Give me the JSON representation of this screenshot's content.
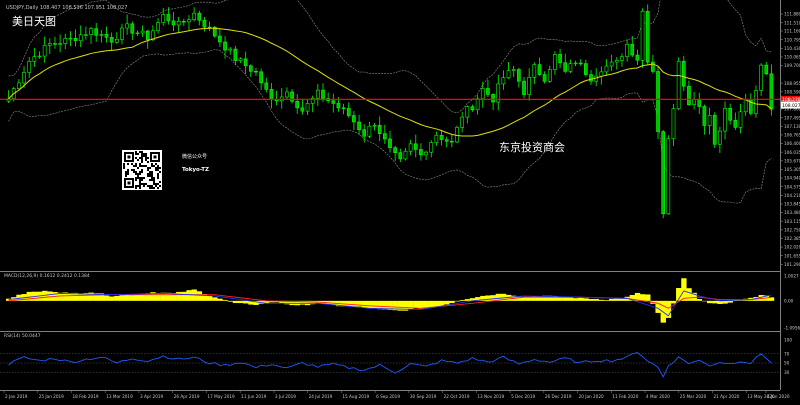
{
  "window": {
    "title": "USDJPY,Daily 108.407 108.536 107.951 108.027"
  },
  "colors": {
    "background": "#000000",
    "bull_candle": "#00ff00",
    "bear_candle": "#00c000",
    "ma_line": "#e0e000",
    "envelope": "#909090",
    "horizontal_line": "#ff0000",
    "current_price_box": "#ffffff",
    "macd_hist": "#ffff00",
    "macd_main": "#2030ff",
    "macd_signal": "#ff2020",
    "rsi_line": "#1e5bff",
    "grid": "#606060",
    "axis_text": "#c8c8c8",
    "overlay_text": "#ffffff"
  },
  "overlays": {
    "corner_label": "美日天图",
    "wechat_label": "微信公众号",
    "wechat_account": "Tokyo-TZ",
    "watermark": "东京投资商会",
    "qr_icon": "qr-code-icon"
  },
  "chart_data": {
    "type": "candlestick",
    "symbol": "USDJPY",
    "timeframe": "Daily",
    "ohlc_title": "USDJPY,Daily 108.407 108.536 107.951 108.027",
    "ylim": [
      101.05,
      112.05
    ],
    "y_ticks": [
      111.88,
      111.51,
      111.16,
      110.795,
      110.43,
      110.065,
      109.7,
      108.955,
      108.59,
      108.23,
      107.86,
      107.495,
      107.13,
      106.765,
      106.4,
      106.035,
      105.67,
      105.305,
      104.94,
      104.575,
      104.21,
      103.845,
      103.48,
      103.115,
      102.75,
      102.385,
      102.02,
      101.655,
      101.29
    ],
    "current_price": 108.027,
    "red_line_price": 108.27,
    "red_line_label": "108.270",
    "x_labels": [
      "2 Jan 2019",
      "25 Jan 2019",
      "18 Feb 2019",
      "13 Mar 2019",
      "3 Apr 2019",
      "26 Apr 2019",
      "17 May 2019",
      "11 Jun 2019",
      "3 Jul 2019",
      "24 Jul 2019",
      "15 Aug 2019",
      "6 Sep 2019",
      "30 Sep 2019",
      "22 Oct 2019",
      "13 Nov 2019",
      "5 Dec 2019",
      "26 Dec 2019",
      "20 Jan 2020",
      "11 Feb 2020",
      "4 Mar 2020",
      "25 Mar 2020",
      "21 Apr 2020",
      "13 May 2020",
      "4 Jun 2020"
    ],
    "price_path": [
      [
        0,
        108.3
      ],
      [
        4,
        109.9
      ],
      [
        8,
        110.6
      ],
      [
        12,
        110.8
      ],
      [
        16,
        111.2
      ],
      [
        20,
        110.8
      ],
      [
        23,
        111.3
      ],
      [
        27,
        110.9
      ],
      [
        30,
        111.8
      ],
      [
        33,
        111.4
      ],
      [
        36,
        111.9
      ],
      [
        40,
        111.0
      ],
      [
        44,
        110.0
      ],
      [
        48,
        109.4
      ],
      [
        51,
        108.2
      ],
      [
        54,
        108.6
      ],
      [
        57,
        107.8
      ],
      [
        60,
        108.5
      ],
      [
        63,
        108.1
      ],
      [
        66,
        107.6
      ],
      [
        69,
        106.8
      ],
      [
        71,
        107.3
      ],
      [
        74,
        106.1
      ],
      [
        76,
        105.6
      ],
      [
        78,
        106.3
      ],
      [
        80,
        105.9
      ],
      [
        83,
        106.8
      ],
      [
        86,
        106.4
      ],
      [
        88,
        107.6
      ],
      [
        90,
        108.0
      ],
      [
        92,
        108.7
      ],
      [
        94,
        108.3
      ],
      [
        96,
        109.2
      ],
      [
        98,
        109.5
      ],
      [
        100,
        108.6
      ],
      [
        102,
        109.6
      ],
      [
        104,
        109.2
      ],
      [
        106,
        110.1
      ],
      [
        108,
        109.4
      ],
      [
        110,
        109.9
      ],
      [
        113,
        109.2
      ],
      [
        115,
        109.6
      ],
      [
        118,
        109.8
      ],
      [
        120,
        110.6
      ],
      [
        122,
        110.0
      ],
      [
        123,
        112.0
      ],
      [
        124,
        110.0
      ],
      [
        125,
        109.5
      ],
      [
        126,
        107.0
      ],
      [
        127,
        103.5
      ],
      [
        128,
        106.5
      ],
      [
        129,
        108.0
      ],
      [
        130,
        110.0
      ],
      [
        131,
        109.0
      ],
      [
        132,
        108.0
      ],
      [
        133,
        108.4
      ],
      [
        134,
        108.0
      ],
      [
        135,
        107.3
      ],
      [
        136,
        107.6
      ],
      [
        137,
        106.4
      ],
      [
        138,
        107.1
      ],
      [
        139,
        107.8
      ],
      [
        140,
        107.4
      ],
      [
        141,
        107.0
      ],
      [
        142,
        107.8
      ],
      [
        143,
        108.1
      ],
      [
        144,
        107.6
      ],
      [
        145,
        108.6
      ],
      [
        146,
        109.8
      ],
      [
        147,
        109.4
      ],
      [
        148,
        108.0
      ]
    ],
    "total_bars": 149,
    "macd": {
      "label": "MACD(12,26,9) 0.1612 0.2412 0.1384",
      "ylim": [
        -1.0956,
        1.0027
      ],
      "y_ticks": [
        1.0027,
        0.0,
        -1.0956
      ],
      "hist_path": [
        [
          0,
          0.1
        ],
        [
          4,
          0.35
        ],
        [
          8,
          0.4
        ],
        [
          12,
          0.3
        ],
        [
          16,
          0.35
        ],
        [
          20,
          0.2
        ],
        [
          24,
          0.25
        ],
        [
          28,
          0.35
        ],
        [
          32,
          0.3
        ],
        [
          36,
          0.45
        ],
        [
          40,
          0.15
        ],
        [
          44,
          -0.1
        ],
        [
          48,
          -0.15
        ],
        [
          52,
          -0.05
        ],
        [
          56,
          -0.2
        ],
        [
          60,
          -0.1
        ],
        [
          64,
          -0.2
        ],
        [
          68,
          -0.25
        ],
        [
          72,
          -0.35
        ],
        [
          76,
          -0.4
        ],
        [
          80,
          -0.3
        ],
        [
          84,
          -0.2
        ],
        [
          88,
          0.05
        ],
        [
          92,
          0.2
        ],
        [
          96,
          0.3
        ],
        [
          100,
          0.15
        ],
        [
          104,
          0.2
        ],
        [
          108,
          0.15
        ],
        [
          112,
          0.1
        ],
        [
          116,
          0.05
        ],
        [
          120,
          0.15
        ],
        [
          122,
          0.3
        ],
        [
          124,
          0.25
        ],
        [
          126,
          -0.5
        ],
        [
          127,
          -0.9
        ],
        [
          128,
          -0.7
        ],
        [
          130,
          0.5
        ],
        [
          131,
          0.9
        ],
        [
          132,
          0.5
        ],
        [
          134,
          0.1
        ],
        [
          136,
          -0.1
        ],
        [
          138,
          -0.15
        ],
        [
          140,
          -0.05
        ],
        [
          142,
          0.05
        ],
        [
          144,
          0.1
        ],
        [
          146,
          0.25
        ],
        [
          148,
          0.16
        ]
      ],
      "main_path": [
        [
          0,
          0.05
        ],
        [
          10,
          0.3
        ],
        [
          20,
          0.25
        ],
        [
          30,
          0.3
        ],
        [
          40,
          0.2
        ],
        [
          50,
          -0.1
        ],
        [
          60,
          -0.1
        ],
        [
          70,
          -0.3
        ],
        [
          80,
          -0.35
        ],
        [
          90,
          0.0
        ],
        [
          100,
          0.2
        ],
        [
          110,
          0.15
        ],
        [
          120,
          0.1
        ],
        [
          126,
          -0.3
        ],
        [
          128,
          -0.6
        ],
        [
          131,
          0.4
        ],
        [
          134,
          0.2
        ],
        [
          138,
          0.0
        ],
        [
          144,
          0.05
        ],
        [
          148,
          0.24
        ]
      ],
      "signal_path": [
        [
          0,
          0.0
        ],
        [
          10,
          0.2
        ],
        [
          20,
          0.25
        ],
        [
          30,
          0.25
        ],
        [
          40,
          0.25
        ],
        [
          50,
          0.0
        ],
        [
          60,
          -0.05
        ],
        [
          70,
          -0.2
        ],
        [
          80,
          -0.3
        ],
        [
          90,
          -0.1
        ],
        [
          100,
          0.15
        ],
        [
          110,
          0.15
        ],
        [
          120,
          0.1
        ],
        [
          126,
          -0.1
        ],
        [
          128,
          -0.3
        ],
        [
          131,
          0.1
        ],
        [
          134,
          0.15
        ],
        [
          138,
          0.05
        ],
        [
          144,
          0.05
        ],
        [
          148,
          0.14
        ]
      ]
    },
    "rsi": {
      "label": "RSI(14) 50.0447",
      "ylim": [
        0,
        100
      ],
      "y_ticks": [
        100,
        70,
        50,
        30,
        0
      ],
      "path": [
        [
          0,
          48
        ],
        [
          3,
          62
        ],
        [
          6,
          55
        ],
        [
          9,
          60
        ],
        [
          12,
          52
        ],
        [
          15,
          58
        ],
        [
          18,
          63
        ],
        [
          21,
          50
        ],
        [
          24,
          60
        ],
        [
          27,
          55
        ],
        [
          30,
          65
        ],
        [
          33,
          58
        ],
        [
          36,
          62
        ],
        [
          39,
          50
        ],
        [
          42,
          45
        ],
        [
          45,
          52
        ],
        [
          48,
          40
        ],
        [
          51,
          48
        ],
        [
          54,
          38
        ],
        [
          57,
          50
        ],
        [
          60,
          42
        ],
        [
          63,
          47
        ],
        [
          66,
          40
        ],
        [
          69,
          35
        ],
        [
          72,
          45
        ],
        [
          75,
          30
        ],
        [
          78,
          48
        ],
        [
          81,
          42
        ],
        [
          84,
          55
        ],
        [
          87,
          50
        ],
        [
          90,
          60
        ],
        [
          93,
          52
        ],
        [
          96,
          62
        ],
        [
          99,
          48
        ],
        [
          102,
          58
        ],
        [
          105,
          52
        ],
        [
          108,
          60
        ],
        [
          111,
          50
        ],
        [
          114,
          56
        ],
        [
          117,
          55
        ],
        [
          120,
          62
        ],
        [
          122,
          75
        ],
        [
          124,
          55
        ],
        [
          126,
          40
        ],
        [
          127,
          20
        ],
        [
          128,
          45
        ],
        [
          130,
          62
        ],
        [
          132,
          50
        ],
        [
          134,
          55
        ],
        [
          136,
          45
        ],
        [
          138,
          52
        ],
        [
          140,
          48
        ],
        [
          142,
          55
        ],
        [
          144,
          50
        ],
        [
          146,
          70
        ],
        [
          147,
          62
        ],
        [
          148,
          50
        ]
      ]
    }
  }
}
